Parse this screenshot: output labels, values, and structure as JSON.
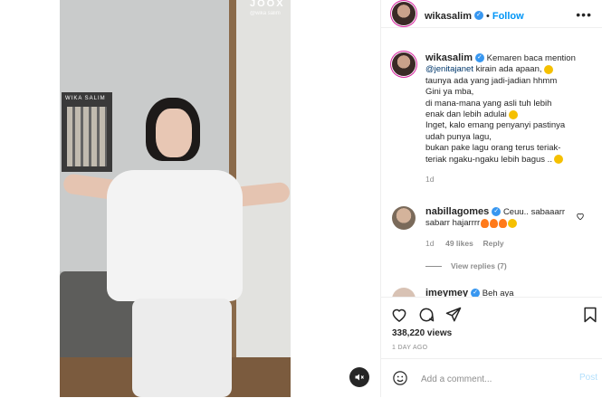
{
  "video": {
    "watermark": "JOOX",
    "watermark_handle": "@wika salim",
    "poster_title": "WIKA SALIM",
    "mute_icon": "mute-icon"
  },
  "header": {
    "username": "wikasalim",
    "separator": "•",
    "follow_label": "Follow",
    "more_label": "•••"
  },
  "caption": {
    "username": "wikasalim",
    "lines": [
      "Kemaren baca mention",
      "kirain ada apaan,",
      "taunya ada yang jadi-jadian hhmm",
      "Gini ya mba,",
      "di mana-mana yang asli tuh lebih",
      "enak dan lebih adulai",
      "Inget, kalo emang penyanyi pastinya",
      "udah punya lagu,",
      "bukan pake lagu orang terus teriak-",
      "teriak ngaku-ngaku lebih bagus .."
    ],
    "mention": "@jenitajanet",
    "time": "1d"
  },
  "comment": {
    "username": "nabillagomes",
    "text_line1": "Ceuu.. sabaaarr",
    "text_line2": "sabarr hajarrrr",
    "time": "1d",
    "likes": "49 likes",
    "reply_label": "Reply",
    "view_replies": "View replies (7)"
  },
  "partial_comment": {
    "username": "imeymey",
    "text": "Beh aya"
  },
  "actions": {
    "views": "338,220 views",
    "posted_ago": "1 DAY AGO"
  },
  "add_comment": {
    "placeholder": "Add a comment...",
    "post_label": "Post"
  },
  "colors": {
    "accent": "#0095f6",
    "verified": "#3897f0",
    "muted_text": "#8e8e8e",
    "post_disabled": "#b2dffc"
  }
}
